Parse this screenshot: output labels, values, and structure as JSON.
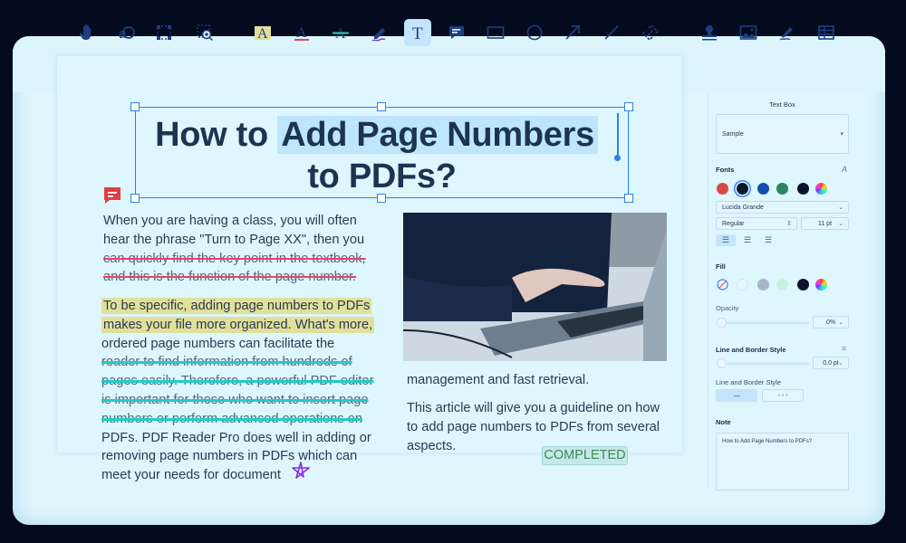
{
  "toolbar": {
    "tools": [
      {
        "name": "hand-tool",
        "icon": "hand-icon"
      },
      {
        "name": "text-select-tool",
        "icon": "text-select-icon"
      },
      {
        "name": "area-select-tool",
        "icon": "area-select-icon"
      },
      {
        "name": "area-zoom-tool",
        "icon": "zoom-area-icon"
      },
      {
        "name": "highlight-tool",
        "icon": "highlight-icon"
      },
      {
        "name": "underline-tool",
        "icon": "underline-icon"
      },
      {
        "name": "strikethrough-tool",
        "icon": "strikethrough-icon"
      },
      {
        "name": "freehand-tool",
        "icon": "pen-icon"
      },
      {
        "name": "text-box-tool",
        "icon": "text-icon",
        "active": true
      },
      {
        "name": "note-tool",
        "icon": "comment-icon"
      },
      {
        "name": "rectangle-tool",
        "icon": "rectangle-icon"
      },
      {
        "name": "circle-tool",
        "icon": "circle-icon"
      },
      {
        "name": "arrow-tool",
        "icon": "arrow-icon"
      },
      {
        "name": "line-tool",
        "icon": "line-icon"
      },
      {
        "name": "link-tool",
        "icon": "link-icon"
      },
      {
        "name": "stamp-tool",
        "icon": "stamp-icon"
      },
      {
        "name": "image-tool",
        "icon": "image-icon"
      },
      {
        "name": "signature-tool",
        "icon": "signature-icon"
      },
      {
        "name": "table-tool",
        "icon": "table-icon"
      }
    ]
  },
  "document": {
    "title_line1_plain": "How to ",
    "title_line1_selected": "Add Page Numbers",
    "title_line2": "to PDFs?",
    "left_column": {
      "p1_normal": [
        "When you are having a class, you will often",
        "hear the phrase \"Turn to Page XX\", then you"
      ],
      "p1_struck": [
        "can quickly find the key point in the textbook,",
        "and this is the function of the page number."
      ],
      "p2_highlighted": [
        " To be specific, adding page numbers to PDFs",
        "makes your file more organized. What's more,"
      ],
      "p2_normal_a": "ordered page numbers can facilitate the",
      "p2_struck": [
        "reader to find information from hundreds of",
        "pages easily. Therefore, a powerful PDF editor",
        "is important for those who want to insert page",
        "numbers or perform advanced operations on"
      ],
      "p2_normal_b": [
        "PDFs. PDF Reader Pro does well in adding or",
        "removing page numbers in PDFs which can",
        "meet your needs for document"
      ]
    },
    "right_column": {
      "image_alt": "hand on laptop trackpad",
      "p2_end": "management and fast retrieval.",
      "p3": [
        "This article will give you a guideline on how",
        "to add page numbers to PDFs from several",
        "aspects."
      ]
    },
    "stamp_label": "COMPLETED",
    "colors": {
      "title": "#1d3451",
      "selection": "#bde5fb",
      "highlight": "#e1e09a",
      "strike_red": "#e0466a",
      "strike_cyan": "#22ccc4",
      "star": "#8a2be2",
      "stamp_text": "#3d8b55"
    }
  },
  "sidebar": {
    "header": "Text Box",
    "style_select": "Sample",
    "fonts_label": "Fonts",
    "font_colors": [
      "#d94a45",
      "#0b1530",
      "#0f4fb0",
      "#2c8560",
      "#0b1530"
    ],
    "font_family": "Lucida Grande",
    "font_weight": "Regular",
    "font_size": "11 pt",
    "alignment": "left",
    "fill_label": "Fill",
    "fill_colors": [
      "none",
      "#e6f6fc",
      "#a7b4c8",
      "#c4f2dc",
      "#0b1530"
    ],
    "opacity_label": "Opacity",
    "opacity_value": "0%",
    "opacity_fraction": 0,
    "line_border_label": "Line and Border Style",
    "line_width_value": "0.0 pt",
    "line_style_label": "Line and Border Style",
    "line_style_solid": "—",
    "line_style_dashed": "- - -",
    "note_label": "Note",
    "note_text": "How to Add Page Numbers to PDFs?"
  }
}
